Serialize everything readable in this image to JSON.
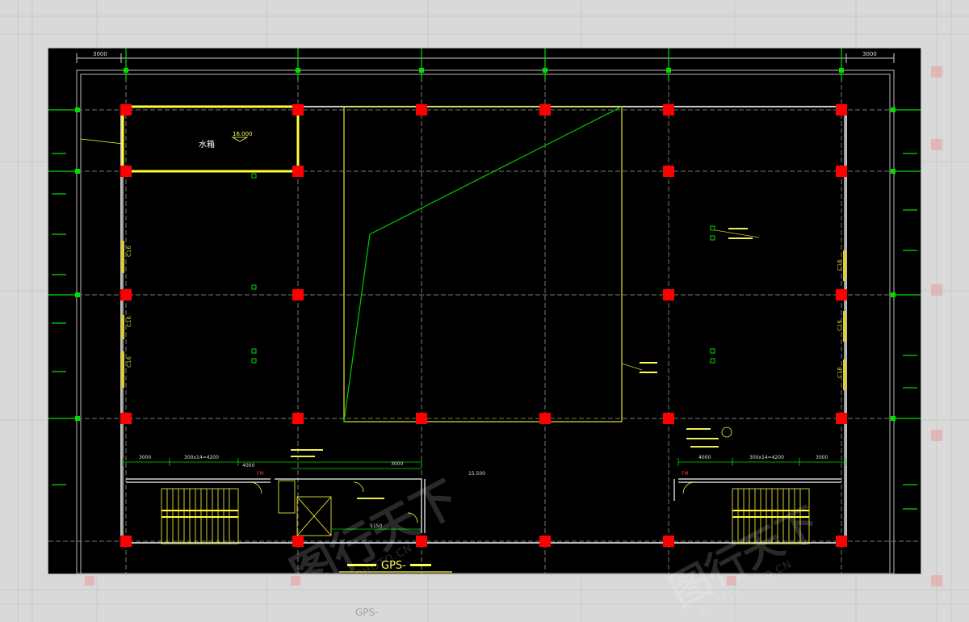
{
  "colors": {
    "page_bg": "#d9d9d9",
    "plan_bg": "#000000",
    "column": "#ff0000",
    "grid_green": "#00dd00",
    "yellow": "#ffff33",
    "dim_line": "#cccccc"
  },
  "labels": {
    "dim_left_top": "3000",
    "dim_right_top": "3000",
    "water_tank": "水箱",
    "elev_tank": "16.000",
    "elev_mid": "15.500",
    "beam_left": "300x14=4200",
    "beam_right": "300x14=4200",
    "dim_3000_left": "3000",
    "dim_3000_mid": "3000",
    "dim_3000_right": "3000",
    "dim_4000_left": "4000",
    "dim_4000_right": "4000",
    "dim_5150": "5150",
    "fm_left": "FM",
    "fm_right": "FM",
    "side_c16_1": "C16",
    "side_c16_2": "C16",
    "side_c16_3": "C16",
    "side_c16_4": "C16",
    "side_c16_5": "C16",
    "side_c16_6": "C16",
    "title": "GPS-",
    "outside_title": "GPS-"
  },
  "watermark": {
    "text": "图行天下",
    "sub": "PHOTOPHOTO.CN"
  }
}
